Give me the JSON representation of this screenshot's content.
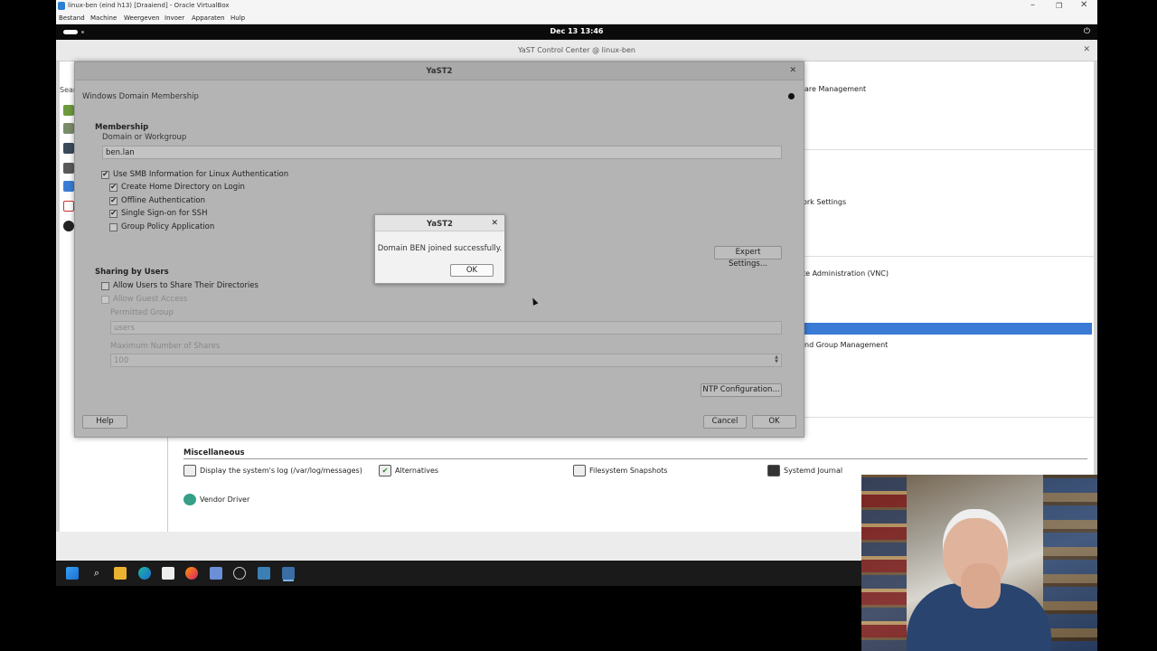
{
  "vbox": {
    "title": "linux-ben (eind h13) [Draaiend] - Oracle VirtualBox",
    "menu": [
      "Bestand",
      "Machine",
      "Weergeven",
      "Invoer",
      "Apparaten",
      "Hulp"
    ],
    "min": "–",
    "max": "❐",
    "close": "✕"
  },
  "gnome": {
    "clock": "Dec 13  13:46",
    "power_icon": "⏻"
  },
  "control_center": {
    "title": "YaST Control Center @ linux-ben",
    "close": "✕",
    "search_label": "Sear",
    "right_items": [
      "are Management",
      "ork Settings",
      "te Administration (VNC)",
      "nd Group Management"
    ],
    "misc_header": "Miscellaneous",
    "misc_items": [
      "Display the system's log (/var/log/messages)",
      "Alternatives",
      "Filesystem Snapshots",
      "Systemd Journal",
      "Vendor Driver"
    ]
  },
  "dialog": {
    "title": "YaST2",
    "close": "✕",
    "heading": "Windows Domain Membership",
    "membership": {
      "group_label": "Membership",
      "domain_label": "Domain or Workgroup",
      "domain_value": "ben.lan",
      "use_smb": "Use SMB Information for Linux Authentication",
      "create_home": "Create Home Directory on Login",
      "offline_auth": "Offline Authentication",
      "sso_ssh": "Single Sign-on for SSH",
      "group_policy": "Group Policy Application",
      "expert_button": "Expert Settings..."
    },
    "sharing": {
      "group_label": "Sharing by Users",
      "allow_share": "Allow Users to Share Their Directories",
      "allow_guest": "Allow Guest Access",
      "permitted_label": "Permitted Group",
      "permitted_value": "users",
      "max_shares_label": "Maximum Number of Shares",
      "max_shares_value": "100"
    },
    "ntp_button": "NTP Configuration...",
    "help_button": "Help",
    "cancel_button": "Cancel",
    "ok_button": "OK"
  },
  "message_box": {
    "title": "YaST2",
    "close": "✕",
    "text": "Domain BEN joined successfully.",
    "ok": "OK"
  },
  "checkmark": "✔",
  "colors": {
    "selection": "#3a7bd5",
    "taskbar": "#1a1a1a",
    "gnome_bar": "#0b0b0b"
  }
}
